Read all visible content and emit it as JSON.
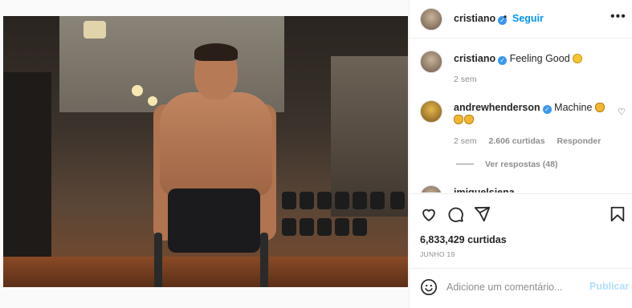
{
  "header": {
    "username": "cristiano",
    "separator": "•",
    "follow_label": "Seguir",
    "more_icon": "more-horizontal-icon"
  },
  "caption": {
    "username": "cristiano",
    "text": "Feeling Good",
    "emoji": "smiling-face-emoji",
    "time": "2 sem"
  },
  "comments": [
    {
      "username": "andrewhenderson",
      "text": "Machine",
      "emoji": "clapping-hands-emoji",
      "time": "2 sem",
      "likes": "2.606 curtidas",
      "reply_label": "Responder",
      "view_replies": "Ver respostas (48)"
    },
    {
      "username": "imiguelsiena",
      "text": ""
    }
  ],
  "actions": {
    "like_icon": "heart-icon",
    "comment_icon": "comment-icon",
    "share_icon": "paper-plane-icon",
    "save_icon": "bookmark-icon",
    "likes_count": "6,833,429 curtidas",
    "date": "JUNHO 19"
  },
  "composer": {
    "placeholder": "Adicione um comentário...",
    "post_label": "Publicar",
    "emoji_icon": "smiley-icon"
  },
  "colors": {
    "link_blue": "#0095f6",
    "verified_blue": "#3897f0",
    "muted_text": "#8e8e8e",
    "border": "#efefef",
    "post_disabled": "#b2dffc"
  }
}
